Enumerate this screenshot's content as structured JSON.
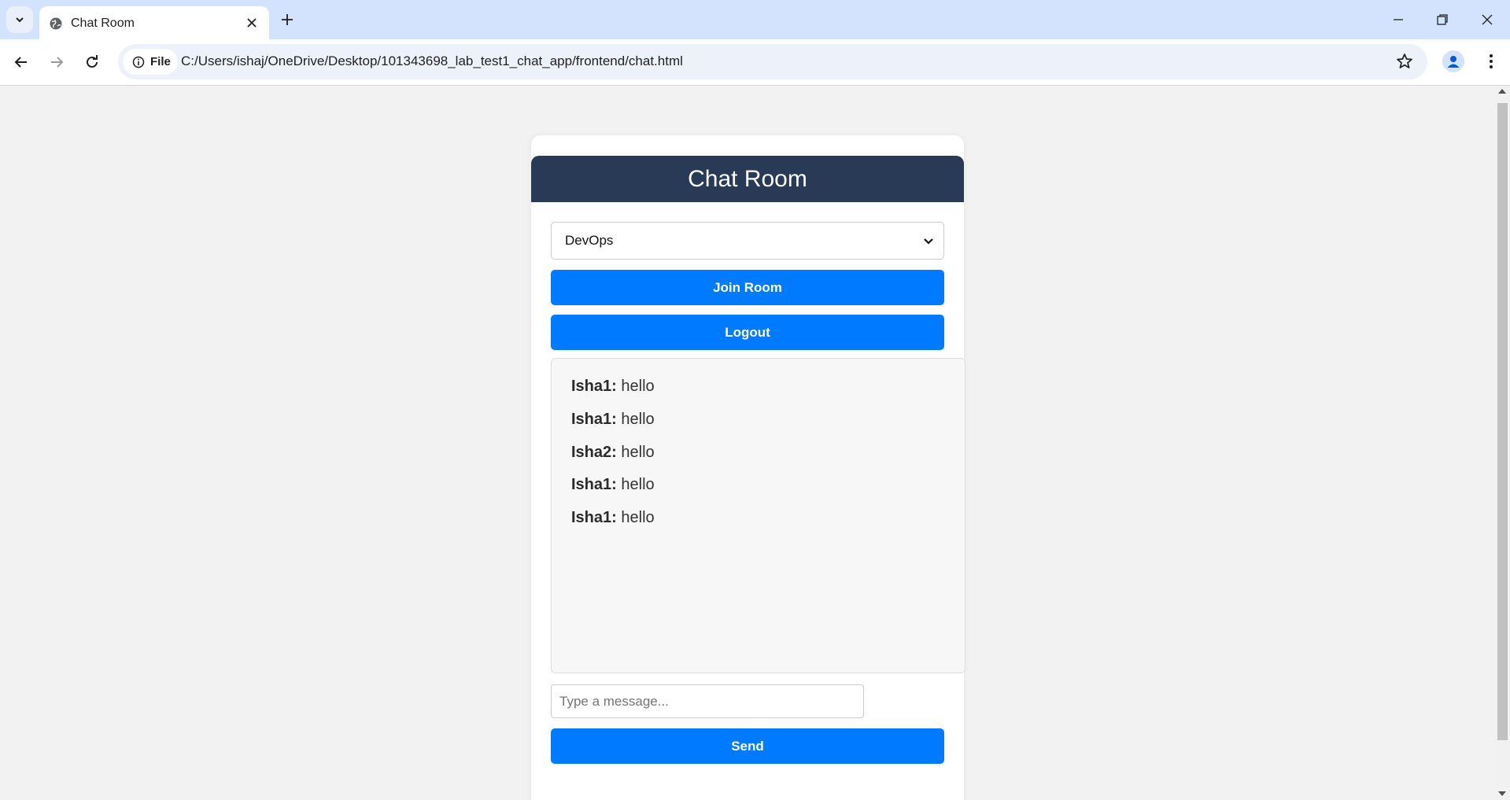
{
  "browser": {
    "tab_title": "Chat Room",
    "site_chip_label": "File",
    "url": "C:/Users/ishaj/OneDrive/Desktop/101343698_lab_test1_chat_app/frontend/chat.html",
    "icons": {
      "tab_search": "chevron-down-icon",
      "favicon": "globe-icon",
      "tab_close": "close-icon",
      "new_tab": "plus-icon",
      "back": "arrow-left-icon",
      "forward": "arrow-right-icon",
      "reload": "reload-icon",
      "site_info": "info-icon",
      "bookmark": "star-icon",
      "profile": "person-icon",
      "menu": "kebab-icon",
      "minimize": "minimize-icon",
      "restore": "restore-icon",
      "close_window": "close-icon"
    }
  },
  "page": {
    "title": "Chat Room",
    "room_select": {
      "selected": "DevOps"
    },
    "join_button": "Join Room",
    "logout_button": "Logout",
    "messages": [
      {
        "user": "Isha1:",
        "text": "hello"
      },
      {
        "user": "Isha1:",
        "text": "hello"
      },
      {
        "user": "Isha2:",
        "text": "hello"
      },
      {
        "user": "Isha1:",
        "text": "hello"
      },
      {
        "user": "Isha1:",
        "text": "hello"
      }
    ],
    "message_input": {
      "placeholder": "Type a message...",
      "value": ""
    },
    "send_button": "Send"
  },
  "colors": {
    "header_bg": "#283a56",
    "accent": "#007bff",
    "page_bg": "#f2f2f2",
    "tabstrip_bg": "#d3e3fd"
  }
}
